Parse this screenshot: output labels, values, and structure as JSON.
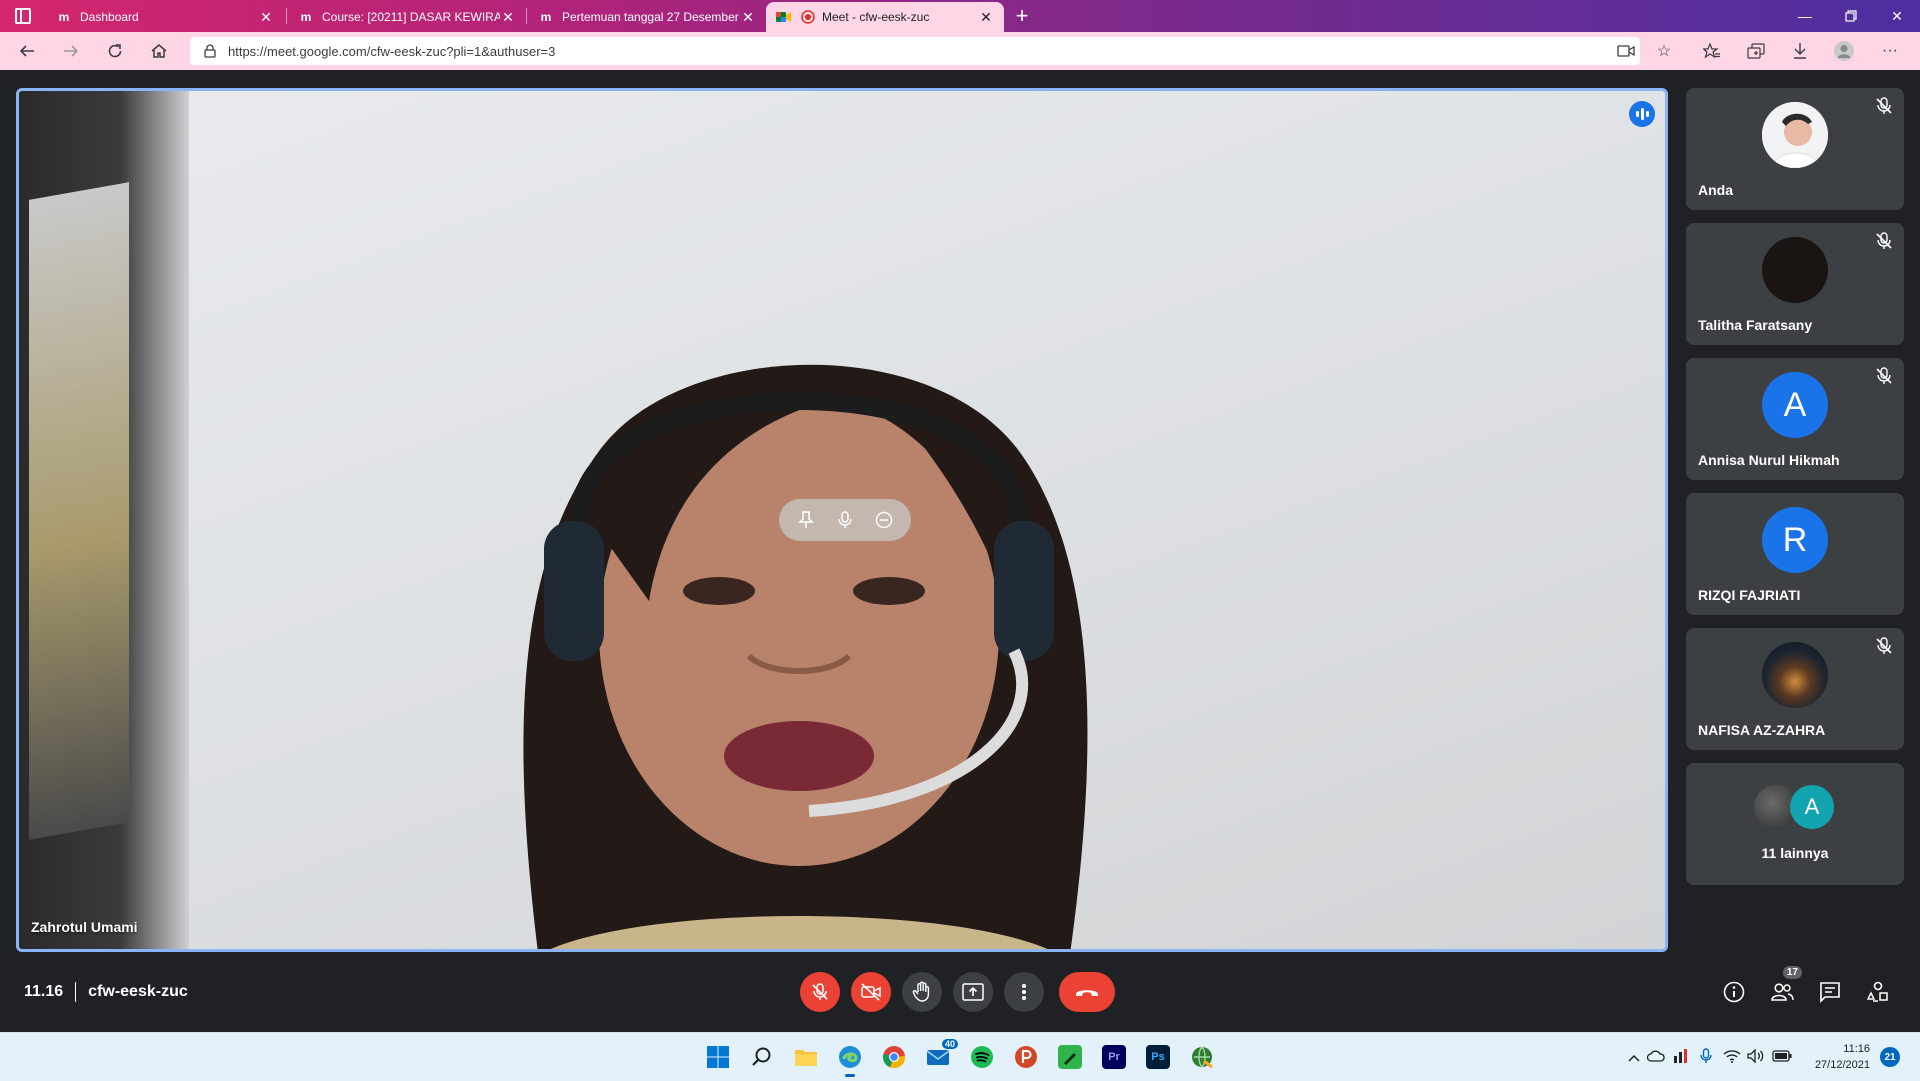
{
  "browser": {
    "tabs": [
      {
        "title": "Dashboard",
        "icon": "moodle-icon"
      },
      {
        "title": "Course: [20211] DASAR KEWIRAUSAHAAN",
        "icon": "moodle-icon"
      },
      {
        "title": "Pertemuan tanggal 27 Desember",
        "icon": "moodle-icon"
      },
      {
        "title": "Meet - cfw-eesk-zuc",
        "icon": "google-meet-icon",
        "active": true
      }
    ],
    "url": "https://meet.google.com/cfw-eesk-zuc?pli=1&authuser=3"
  },
  "meet": {
    "main_speaker": "Zahrotul Umami",
    "participants": [
      {
        "name": "Anda",
        "avatar": "photo",
        "muted": true
      },
      {
        "name": "Talitha Faratsany",
        "avatar": "photo-dark",
        "muted": true
      },
      {
        "name": "Annisa Nurul Hikmah",
        "avatar": "letter",
        "letter": "A",
        "color": "#1a73e8",
        "muted": true
      },
      {
        "name": "RIZQI FAJRIATI",
        "avatar": "letter",
        "letter": "R",
        "color": "#1a73e8",
        "muted": false
      },
      {
        "name": "NAFISA AZ-ZAHRA",
        "avatar": "photo-night",
        "muted": true
      }
    ],
    "more": {
      "label": "11 lainnya",
      "letter": "A"
    },
    "time": "11.16",
    "meeting_code": "cfw-eesk-zuc",
    "participant_count": "17"
  },
  "taskbar": {
    "mail_badge": "40",
    "clock_time": "11:16",
    "clock_date": "27/12/2021",
    "notifications": "21"
  },
  "colors": {
    "accent": "#1a73e8",
    "danger": "#ea4335",
    "tile": "#3c4043",
    "bar": "#202124"
  }
}
